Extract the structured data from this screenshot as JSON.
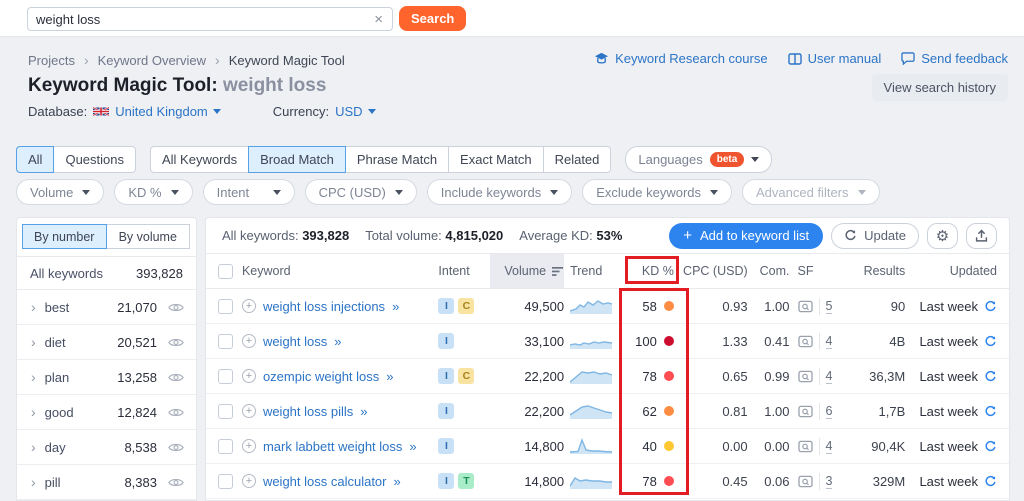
{
  "topbar": {
    "search_value": "weight loss",
    "clear_icon": "×",
    "search_button": "Search"
  },
  "breadcrumb": {
    "items": [
      "Projects",
      "Keyword Overview",
      "Keyword Magic Tool"
    ],
    "separator": "›"
  },
  "quick_links": {
    "course": "Keyword Research course",
    "manual": "User manual",
    "feedback": "Send feedback"
  },
  "page_header": {
    "title": "Keyword Magic Tool:",
    "query": "weight loss",
    "view_history": "View search history",
    "database_label": "Database:",
    "database_value": "United Kingdom",
    "currency_label": "Currency:",
    "currency_value": "USD"
  },
  "match_tabs": {
    "group1": [
      {
        "label": "All",
        "active": true
      },
      {
        "label": "Questions",
        "active": false
      }
    ],
    "group2": [
      {
        "label": "All Keywords",
        "active": false
      },
      {
        "label": "Broad Match",
        "active": true
      },
      {
        "label": "Phrase Match",
        "active": false
      },
      {
        "label": "Exact Match",
        "active": false
      },
      {
        "label": "Related",
        "active": false
      }
    ],
    "languages": {
      "label": "Languages",
      "badge": "beta"
    }
  },
  "filters": {
    "volume": "Volume",
    "kd": "KD %",
    "intent": "Intent",
    "cpc": "CPC (USD)",
    "include": "Include keywords",
    "exclude": "Exclude keywords",
    "advanced": "Advanced filters"
  },
  "sidebar": {
    "toggle": {
      "by_number": "By number",
      "by_volume": "By volume"
    },
    "header": {
      "label": "All keywords",
      "value": "393,828"
    },
    "groups": [
      {
        "label": "best",
        "value": "21,070"
      },
      {
        "label": "diet",
        "value": "20,521"
      },
      {
        "label": "plan",
        "value": "13,258"
      },
      {
        "label": "good",
        "value": "12,824"
      },
      {
        "label": "day",
        "value": "8,538"
      },
      {
        "label": "pill",
        "value": "8,383"
      }
    ]
  },
  "toolbar": {
    "stats": [
      {
        "label": "All keywords:",
        "value": "393,828"
      },
      {
        "label": "Total volume:",
        "value": "4,815,020"
      },
      {
        "label": "Average KD:",
        "value": "53%"
      }
    ],
    "add_plus": "+",
    "add_button": "Add to keyword list",
    "update_button": "Update"
  },
  "table": {
    "columns": {
      "keyword": "Keyword",
      "intent": "Intent",
      "volume": "Volume",
      "trend": "Trend",
      "kd": "KD %",
      "cpc": "CPC (USD)",
      "com": "Com.",
      "sf": "SF",
      "results": "Results",
      "updated": "Updated"
    },
    "expand_icon": "»",
    "rows": [
      {
        "keyword": "weight loss injections",
        "intents": [
          {
            "label": "I",
            "type": "informational"
          },
          {
            "label": "C",
            "type": "commercial"
          }
        ],
        "volume": "49,500",
        "kd": "58",
        "kd_level": "orange",
        "cpc": "0.93",
        "com": "1.00",
        "sf": "5",
        "results": "90",
        "updated": "Last week"
      },
      {
        "keyword": "weight loss",
        "intents": [
          {
            "label": "I",
            "type": "informational"
          }
        ],
        "volume": "33,100",
        "kd": "100",
        "kd_level": "darkred",
        "cpc": "1.33",
        "com": "0.41",
        "sf": "4",
        "results": "4B",
        "updated": "Last week"
      },
      {
        "keyword": "ozempic weight loss",
        "intents": [
          {
            "label": "I",
            "type": "informational"
          },
          {
            "label": "C",
            "type": "commercial"
          }
        ],
        "volume": "22,200",
        "kd": "78",
        "kd_level": "red",
        "cpc": "0.65",
        "com": "0.99",
        "sf": "4",
        "results": "36,3M",
        "updated": "Last week"
      },
      {
        "keyword": "weight loss pills",
        "intents": [
          {
            "label": "I",
            "type": "informational"
          }
        ],
        "volume": "22,200",
        "kd": "62",
        "kd_level": "orange",
        "cpc": "0.81",
        "com": "1.00",
        "sf": "6",
        "results": "1,7B",
        "updated": "Last week"
      },
      {
        "keyword": "mark labbett weight loss",
        "intents": [
          {
            "label": "I",
            "type": "informational"
          }
        ],
        "volume": "14,800",
        "kd": "40",
        "kd_level": "yellow",
        "cpc": "0.00",
        "com": "0.00",
        "sf": "4",
        "results": "90,4K",
        "updated": "Last week"
      },
      {
        "keyword": "weight loss calculator",
        "intents": [
          {
            "label": "I",
            "type": "informational"
          },
          {
            "label": "T",
            "type": "transactional"
          }
        ],
        "volume": "14,800",
        "kd": "78",
        "kd_level": "red",
        "cpc": "0.45",
        "com": "0.06",
        "sf": "3",
        "results": "329M",
        "updated": "Last week"
      }
    ]
  },
  "colors": {
    "brand_orange": "#ff642d",
    "link_blue": "#2c74c6",
    "accent_blue": "#2e84ef",
    "kd_orange": "#ff8c43",
    "kd_red": "#ff4d52",
    "kd_darkred": "#cb0e2f",
    "kd_yellow": "#ffc731",
    "annotation_red": "#e31b23"
  }
}
